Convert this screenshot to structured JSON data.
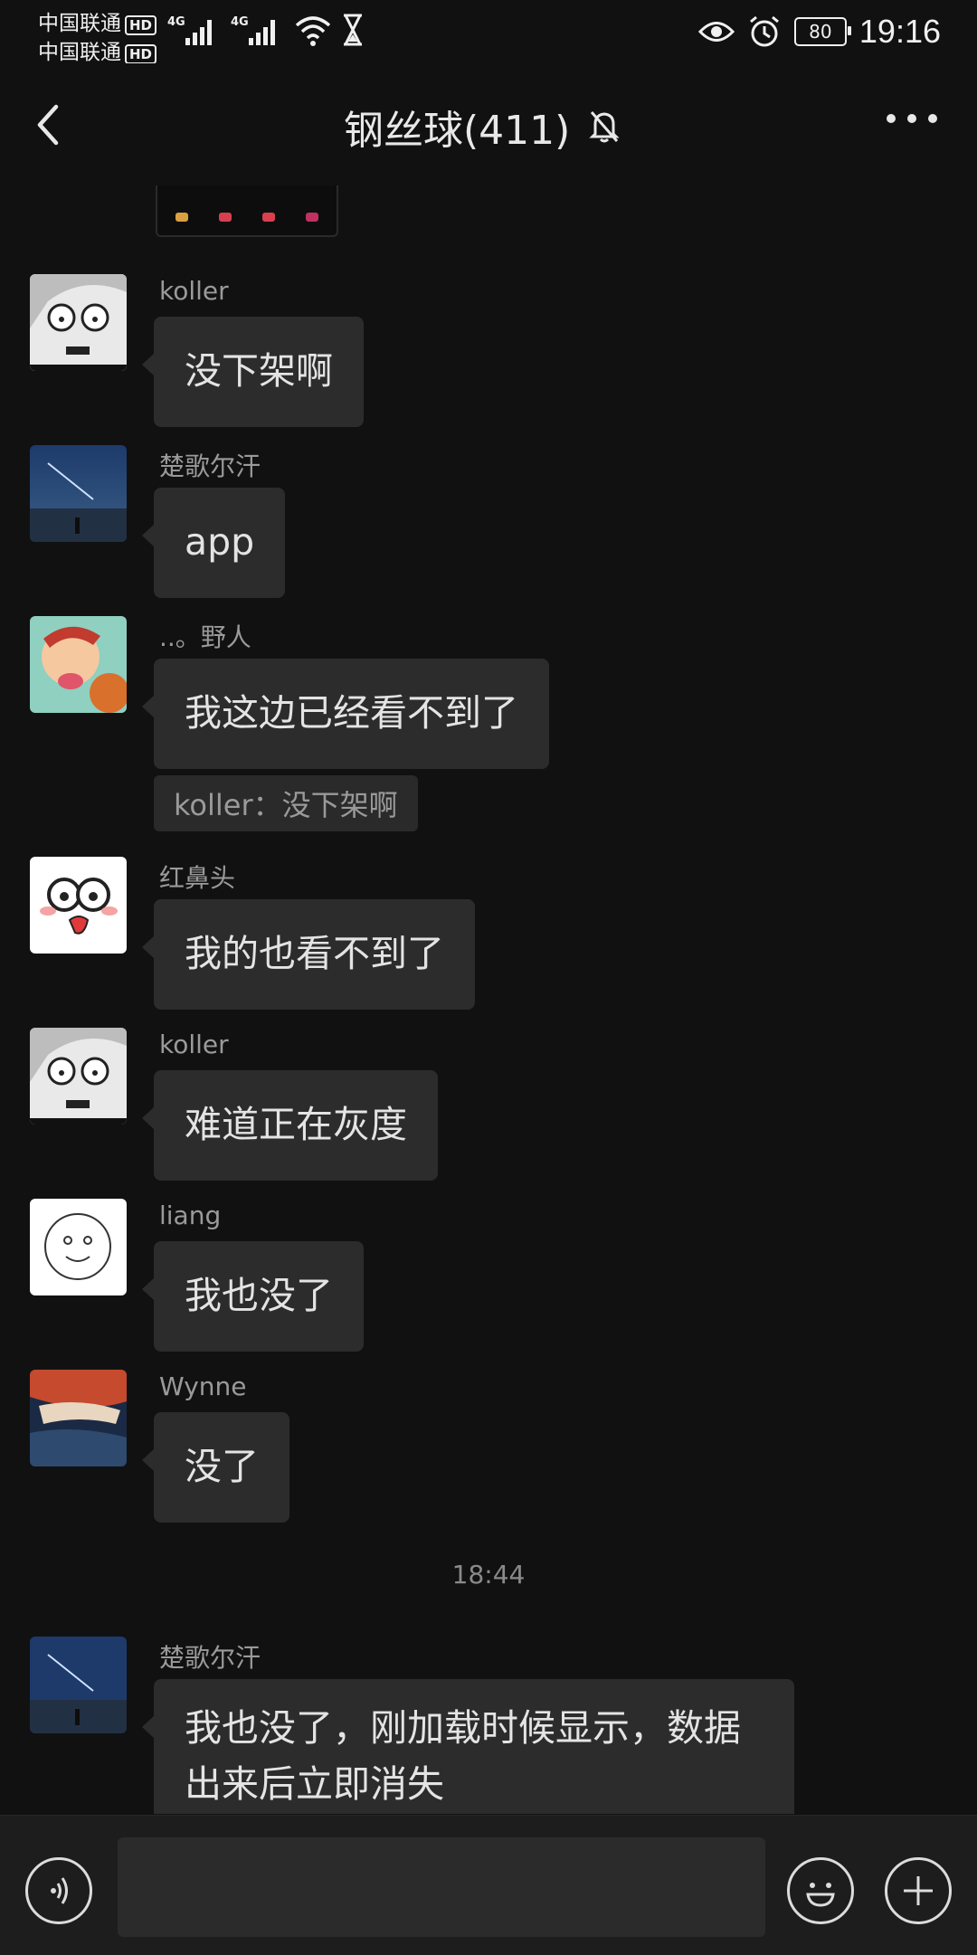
{
  "status_bar": {
    "carrier1": "中国联通",
    "carrier2": "中国联通",
    "hd": "HD",
    "network1": "4G",
    "network2": "4G",
    "battery": "80",
    "time": "19:16"
  },
  "header": {
    "title": "钢丝球(411)",
    "back_icon": "chevron-left-icon",
    "mute_icon": "bell-off-icon",
    "more_icon": "more-dots-icon"
  },
  "messages": [
    {
      "sender": "koller",
      "text": "没下架啊"
    },
    {
      "sender": "楚歌尔汗",
      "text": "app"
    },
    {
      "sender": "..。野人",
      "text": "我这边已经看不到了",
      "quote": "koller：没下架啊"
    },
    {
      "sender": "红鼻头",
      "text": "我的也看不到了"
    },
    {
      "sender": "koller",
      "text": "难道正在灰度"
    },
    {
      "sender": "liang",
      "text": "我也没了"
    },
    {
      "sender": "Wynne",
      "text": "没了"
    },
    {
      "sender": "楚歌尔汗",
      "text": "我也没了，刚加载时候显示，数据出来后立即消失"
    }
  ],
  "time_divider": "18:44",
  "input_bar": {
    "voice_icon": "voice-icon",
    "emoji_icon": "emoji-icon",
    "plus_icon": "plus-icon",
    "input_value": ""
  },
  "colors": {
    "background": "#111111",
    "bubble": "#2c2c2c",
    "sender_text": "#9a9a9a",
    "input_bar": "#1d1d1d"
  }
}
